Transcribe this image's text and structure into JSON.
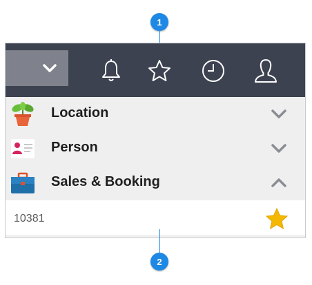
{
  "callouts": [
    {
      "label": "1"
    },
    {
      "label": "2"
    }
  ],
  "toolbar": {
    "icons": [
      "chevron-down-icon",
      "bell-icon",
      "star-outline-icon",
      "clock-icon",
      "user-icon"
    ]
  },
  "menu": {
    "items": [
      {
        "label": "Location",
        "icon": "plant-icon",
        "expanded": false
      },
      {
        "label": "Person",
        "icon": "person-card-icon",
        "expanded": false
      },
      {
        "label": "Sales & Booking",
        "icon": "briefcase-icon",
        "expanded": true
      }
    ]
  },
  "list": {
    "rows": [
      {
        "value": "10381",
        "favorite": true,
        "icon": "star-filled-icon"
      }
    ]
  },
  "colors": {
    "toolbar_bg": "#3d4250",
    "dropdown_bg": "#7f828c",
    "menu_bg": "#efefef",
    "callout": "#1e88e5",
    "star": "#f5b800"
  }
}
